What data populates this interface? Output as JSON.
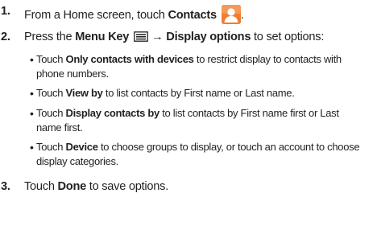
{
  "steps": [
    {
      "number": "1.",
      "pre": "From a Home screen, touch ",
      "bold": "Contacts",
      "post": "."
    },
    {
      "number": "2.",
      "pre": "Press the ",
      "bold": "Menu Key",
      "arrow": "→",
      "bold2": "Display options",
      "post": " to set options:"
    },
    {
      "number": "3.",
      "pre": "Touch ",
      "bold": "Done",
      "post": " to save options."
    }
  ],
  "sub_items": [
    {
      "pre": "Touch ",
      "bold": "Only contacts with devices",
      "post": " to restrict display to contacts with phone numbers."
    },
    {
      "pre": "Touch ",
      "bold": "View by",
      "post": " to list contacts by First name or Last name."
    },
    {
      "pre": "Touch ",
      "bold": "Display contacts by",
      "post": " to list contacts by First name first or Last name first."
    },
    {
      "pre": "Touch ",
      "bold": "Device",
      "post": " to choose groups to display, or touch an account to choose display categories."
    }
  ],
  "bullet_symbol": "•",
  "icons": {
    "contacts": "contacts-icon",
    "menu_key": "menu-key-icon"
  },
  "colors": {
    "text": "#231f20",
    "contacts_icon_bg": "#ef7d31"
  }
}
